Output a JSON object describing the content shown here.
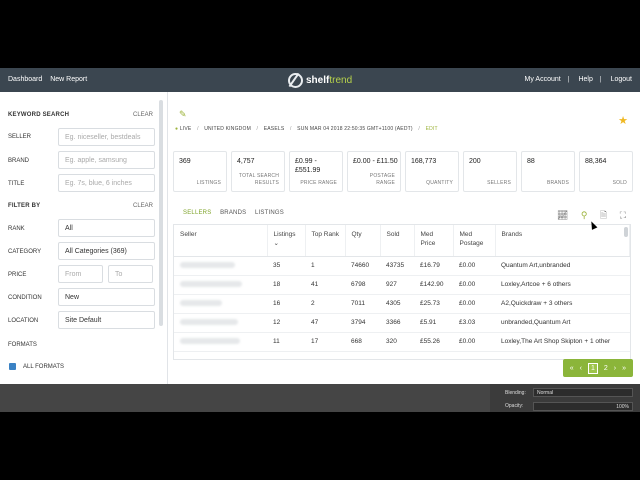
{
  "nav": {
    "dashboard": "Dashboard",
    "new_report": "New Report",
    "brand_shelf": "shelf",
    "brand_trend": "trend",
    "my_account": "My Account",
    "help": "Help",
    "logout": "Logout",
    "separator": "|"
  },
  "sidebar": {
    "keyword_search": "KEYWORD SEARCH",
    "clear1": "CLEAR",
    "seller_label": "SELLER",
    "seller_placeholder": "Eg. niceseller, bestdeals",
    "brand_label": "BRAND",
    "brand_placeholder": "Eg. apple, samsung",
    "title_label": "TITLE",
    "title_placeholder": "Eg. 7s, blue, 6 inches",
    "filter_by": "FILTER BY",
    "clear2": "CLEAR",
    "rank_label": "RANK",
    "rank_value": "All",
    "category_label": "CATEGORY",
    "category_value": "All Categories (369)",
    "price_label": "PRICE",
    "price_from": "From",
    "price_to": "To",
    "condition_label": "CONDITION",
    "condition_value": "New",
    "location_label": "LOCATION",
    "location_value": "Site Default",
    "formats_label": "FORMATS",
    "all_formats": "ALL FORMATS"
  },
  "header": {
    "live": "LIVE",
    "country": "UNITED KINGDOM",
    "category": "EASELS",
    "date": "SUN MAR 04 2018 22:50:35 GMT+1100 (AEDT)",
    "edit": "EDIT"
  },
  "stats": [
    {
      "value": "369",
      "label": "LISTINGS"
    },
    {
      "value": "4,757",
      "label": "TOTAL SEARCH RESULTS"
    },
    {
      "value": "£0.99 - £551.99",
      "label": "PRICE RANGE"
    },
    {
      "value": "£0.00 - £11.50",
      "label": "POSTAGE RANGE"
    },
    {
      "value": "168,773",
      "label": "QUANTITY"
    },
    {
      "value": "200",
      "label": "SELLERS"
    },
    {
      "value": "88",
      "label": "BRANDS"
    },
    {
      "value": "88,364",
      "label": "SOLD"
    }
  ],
  "tabs": [
    "SELLERS",
    "BRANDS",
    "LISTINGS"
  ],
  "table": {
    "headers": [
      "Seller",
      "Listings",
      "Top Rank",
      "Qty",
      "Sold",
      "Med Price",
      "Med Postage",
      "Brands"
    ],
    "sort_arrow": "⌄",
    "rows": [
      {
        "listings": "35",
        "rank": "1",
        "qty": "74660",
        "sold": "43735",
        "price": "£16.79",
        "postage": "£0.00",
        "brands": "Quantum Art,unbranded"
      },
      {
        "listings": "18",
        "rank": "41",
        "qty": "6798",
        "sold": "927",
        "price": "£142.90",
        "postage": "£0.00",
        "brands": "Loxley,Artcoe + 6 others"
      },
      {
        "listings": "16",
        "rank": "2",
        "qty": "7011",
        "sold": "4305",
        "price": "£25.73",
        "postage": "£0.00",
        "brands": "A2,Quickdraw + 3 others"
      },
      {
        "listings": "12",
        "rank": "47",
        "qty": "3794",
        "sold": "3366",
        "price": "£5.91",
        "postage": "£3.03",
        "brands": "unbranded,Quantum Art"
      },
      {
        "listings": "11",
        "rank": "17",
        "qty": "668",
        "sold": "320",
        "price": "£55.26",
        "postage": "£0.00",
        "brands": "Loxley,The Art Shop Skipton + 1 other"
      }
    ]
  },
  "pager": {
    "prev2": "«",
    "prev": "‹",
    "p1": "1",
    "p2": "2",
    "next": "›",
    "next2": "»"
  },
  "bottom": {
    "blending_label": "Blending:",
    "blending_value": "Normal",
    "opacity_label": "Opacity:",
    "opacity_value": "100%"
  },
  "colors": {
    "accent": "#8bb53a",
    "nav": "#3b4650",
    "star": "#f0b823"
  }
}
